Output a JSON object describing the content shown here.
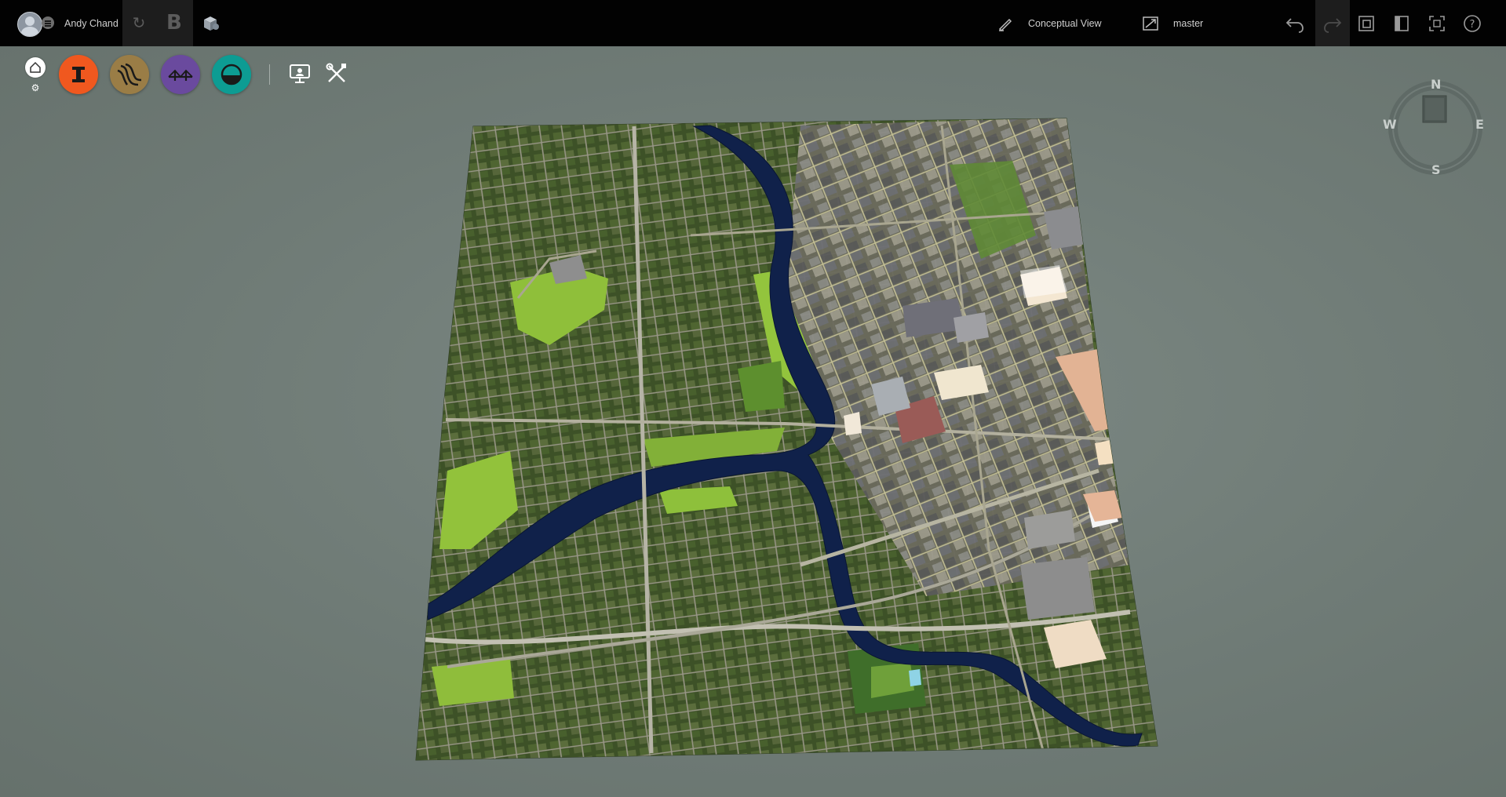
{
  "topbar": {
    "user_name": "Andy Chand",
    "view_mode_label": "Conceptual View",
    "branch_label": "master",
    "icons": {
      "avatar": "user-avatar",
      "menu": "hamburger-menu-icon",
      "sync": "sync-icon",
      "bold_b": "bentley-b-icon",
      "cube": "3d-model-icon",
      "view_mode": "pencil-view-icon",
      "branch": "branch-icon",
      "undo": "undo-icon",
      "redo": "redo-icon",
      "layers": "layers-icon",
      "panel": "panel-icon",
      "fullscreen": "fullscreen-icon",
      "help": "help-icon"
    }
  },
  "toolbar": {
    "home": "home-icon",
    "settings": "gear-icon",
    "tools": [
      {
        "name": "structure-tool",
        "color": "#f0581f"
      },
      {
        "name": "road-tool",
        "color": "#9a7d46"
      },
      {
        "name": "bridge-tool",
        "color": "#6a4a9e"
      },
      {
        "name": "water-tool",
        "color": "#0d9c93"
      }
    ],
    "presentation": "presentation-icon",
    "tools_menu": "tools-icon"
  },
  "compass": {
    "north": "N",
    "south": "S",
    "east": "E",
    "west": "W"
  },
  "scene": {
    "description_color_river": "#10204a",
    "description_color_terrain": "#3c5a2a",
    "background": "#727e79"
  }
}
